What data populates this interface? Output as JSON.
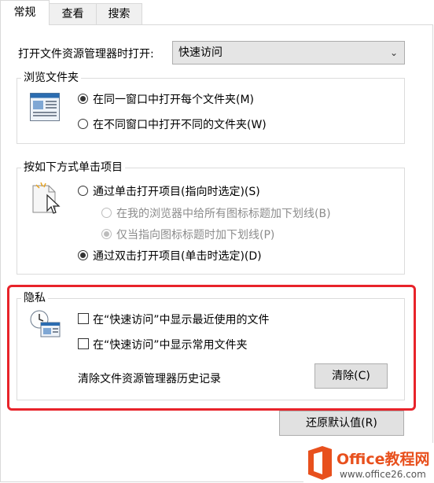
{
  "tabs": [
    {
      "label": "常规"
    },
    {
      "label": "查看"
    },
    {
      "label": "搜索"
    }
  ],
  "open_explorer": {
    "label": "打开文件资源管理器时打开:",
    "selected": "快速访问"
  },
  "browse_folders": {
    "title": "浏览文件夹",
    "same_window": "在同一窗口中打开每个文件夹(M)",
    "new_window": "在不同窗口中打开不同的文件夹(W)"
  },
  "click_items": {
    "title": "按如下方式单击项目",
    "single_click": "通过单击打开项目(指向时选定)(S)",
    "underline_all": "在我的浏览器中给所有图标标题加下划线(B)",
    "underline_point": "仅当指向图标标题时加下划线(P)",
    "double_click": "通过双击打开项目(单击时选定)(D)"
  },
  "privacy": {
    "title": "隐私",
    "recent_files": "在“快速访问”中显示最近使用的文件",
    "frequent_folders": "在“快速访问”中显示常用文件夹",
    "clear_history_label": "清除文件资源管理器历史记录",
    "clear_button": "清除(C)"
  },
  "restore_defaults": "还原默认值(R)",
  "watermark": {
    "brand": "Office教程网",
    "url": "www.office26.com",
    "accent": "#e8501d"
  },
  "highlight_color": "#e8232a"
}
